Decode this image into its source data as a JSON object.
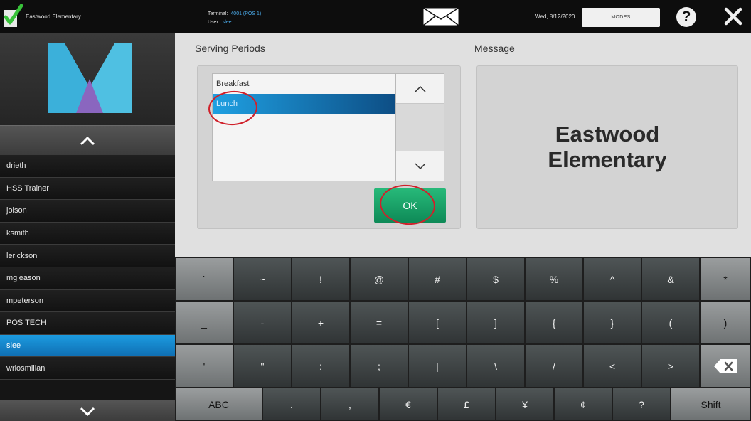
{
  "topbar": {
    "school_name": "Eastwood Elementary",
    "terminal_label": "Terminal:",
    "terminal_value": "4001 (POS 1)",
    "user_label": "User:",
    "user_value": "slee",
    "date": "Wed, 8/12/2020",
    "modes_label": "MODES",
    "help_glyph": "?",
    "icons": [
      "check-icon",
      "mail-icon",
      "help-icon",
      "close-icon"
    ]
  },
  "sidebar": {
    "users": [
      "drieth",
      "HSS Trainer",
      "jolson",
      "ksmith",
      "lerickson",
      "mgleason",
      "mpeterson",
      "POS TECH",
      "slee",
      "wriosmillan"
    ],
    "selected_user": "slee"
  },
  "main": {
    "serving_periods_title": "Serving Periods",
    "message_title": "Message",
    "periods": [
      "Breakfast",
      "Lunch"
    ],
    "selected_period": "Lunch",
    "ok_label": "OK",
    "message_text": "Eastwood Elementary"
  },
  "keyboard": {
    "row1": [
      "`",
      "~",
      "!",
      "@",
      "#",
      "$",
      "%",
      "^",
      "&",
      "*"
    ],
    "row2": [
      "_",
      "-",
      "+",
      "=",
      "[",
      "]",
      "{",
      "}",
      "(",
      ")"
    ],
    "row3": [
      "'",
      "\"",
      ":",
      ";",
      "|",
      "\\",
      "/",
      "<",
      ">"
    ],
    "row4": [
      "ABC",
      ".",
      ",",
      "€",
      "£",
      "¥",
      "¢",
      "?",
      "Shift"
    ]
  },
  "colors": {
    "accent_blue": "#1c9be0",
    "ok_green": "#14a066",
    "annotation_red": "#d0202a"
  }
}
